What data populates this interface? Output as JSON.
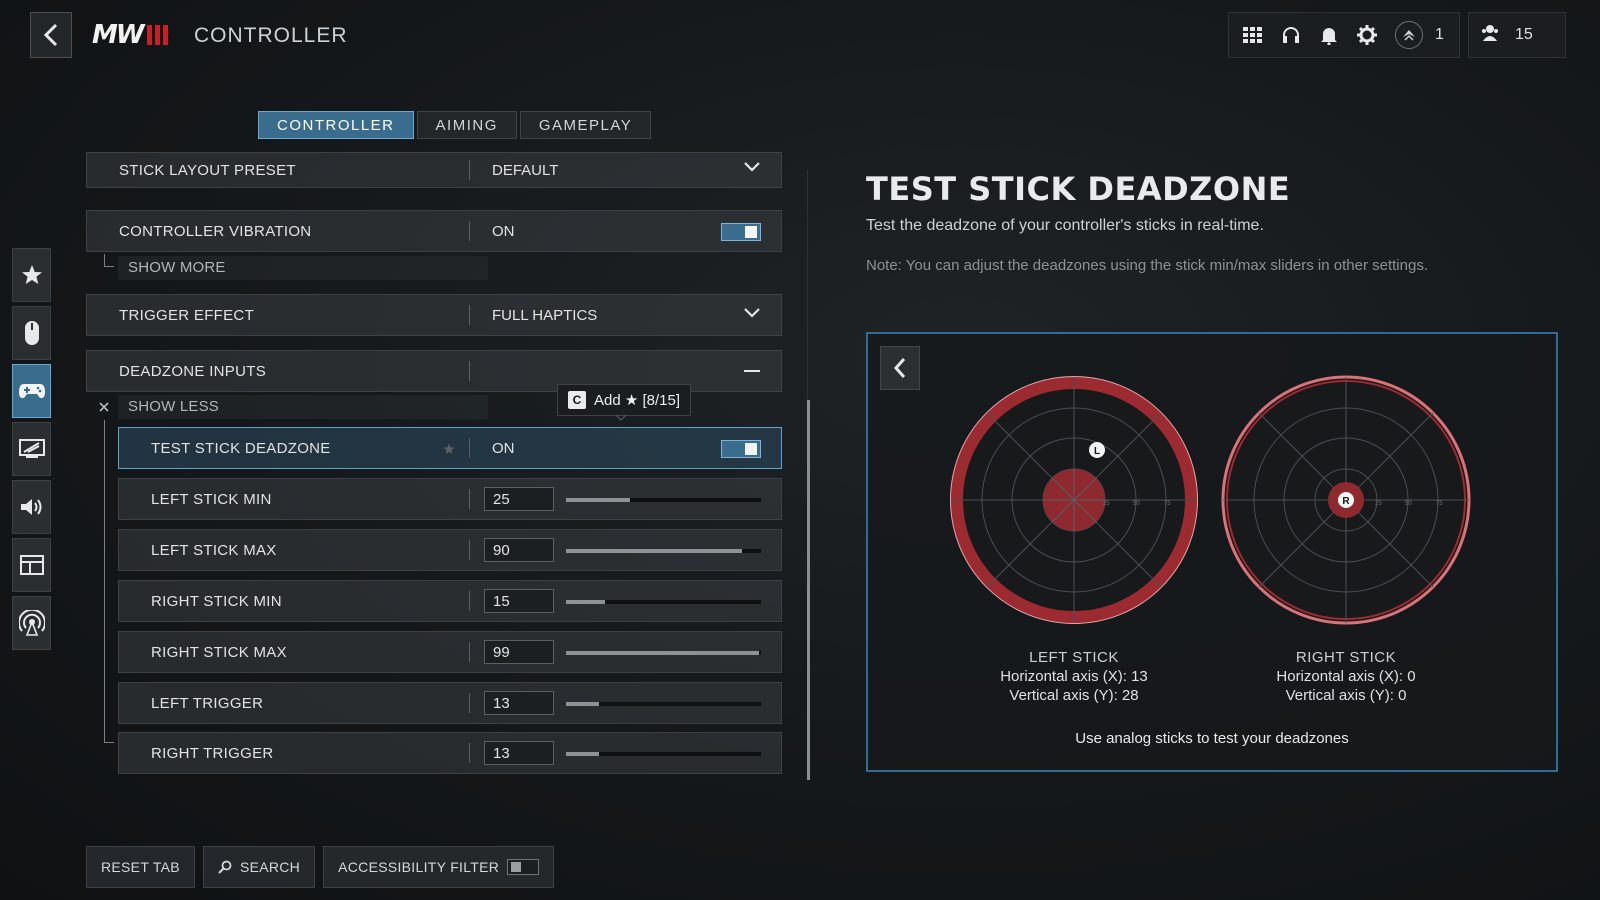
{
  "header": {
    "logo_text": "MW",
    "title": "CONTROLLER",
    "rank_count": "1",
    "party_count": "15"
  },
  "tabs": [
    {
      "label": "CONTROLLER",
      "active": true
    },
    {
      "label": "AIMING",
      "active": false
    },
    {
      "label": "GAMEPLAY",
      "active": false
    }
  ],
  "sidebar": {
    "items": [
      {
        "icon": "star-icon"
      },
      {
        "icon": "mouse-icon"
      },
      {
        "icon": "gamepad-icon",
        "active": true
      },
      {
        "icon": "display-icon"
      },
      {
        "icon": "speaker-icon"
      },
      {
        "icon": "interface-icon"
      },
      {
        "icon": "network-icon"
      }
    ]
  },
  "settings": {
    "stick_layout": {
      "label": "STICK LAYOUT PRESET",
      "value": "DEFAULT"
    },
    "vibration": {
      "label": "CONTROLLER VIBRATION",
      "value": "ON"
    },
    "show_more": "SHOW MORE",
    "trigger_effect": {
      "label": "TRIGGER EFFECT",
      "value": "FULL HAPTICS"
    },
    "deadzone_inputs": {
      "label": "DEADZONE INPUTS"
    },
    "show_less": "SHOW LESS",
    "test_stick": {
      "label": "TEST STICK DEADZONE",
      "value": "ON"
    },
    "sliders": [
      {
        "label": "LEFT STICK MIN",
        "value": "25",
        "level": 0.33
      },
      {
        "label": "LEFT STICK MAX",
        "value": "90",
        "level": 0.9
      },
      {
        "label": "RIGHT STICK MIN",
        "value": "15",
        "level": 0.2
      },
      {
        "label": "RIGHT STICK MAX",
        "value": "99",
        "level": 0.99
      },
      {
        "label": "LEFT TRIGGER",
        "value": "13",
        "level": 0.17
      },
      {
        "label": "RIGHT TRIGGER",
        "value": "13",
        "level": 0.17
      }
    ]
  },
  "tooltip": {
    "key": "C",
    "text": "Add ★ [8/15]"
  },
  "test_panel": {
    "title": "TEST STICK DEADZONE",
    "description": "Test the deadzone of your controller's sticks in real-time.",
    "note": "Note: You can adjust the deadzones using the stick min/max sliders in other settings.",
    "left_stick": {
      "name": "LEFT STICK",
      "marker": "L",
      "horizontal": "Horizontal axis (X): 13",
      "vertical": "Vertical axis (Y): 28"
    },
    "right_stick": {
      "name": "RIGHT STICK",
      "marker": "R",
      "horizontal": "Horizontal axis (X): 0",
      "vertical": "Vertical axis (Y): 0"
    },
    "ring_labels": [
      "25",
      "50",
      "75"
    ],
    "footer": "Use analog sticks to test your deadzones"
  },
  "bottom_bar": {
    "reset": "RESET TAB",
    "search": "SEARCH",
    "accessibility": "ACCESSIBILITY FILTER"
  },
  "colors": {
    "accent_blue": "#3a6c8e",
    "deadzone_red": "#c8323c"
  }
}
